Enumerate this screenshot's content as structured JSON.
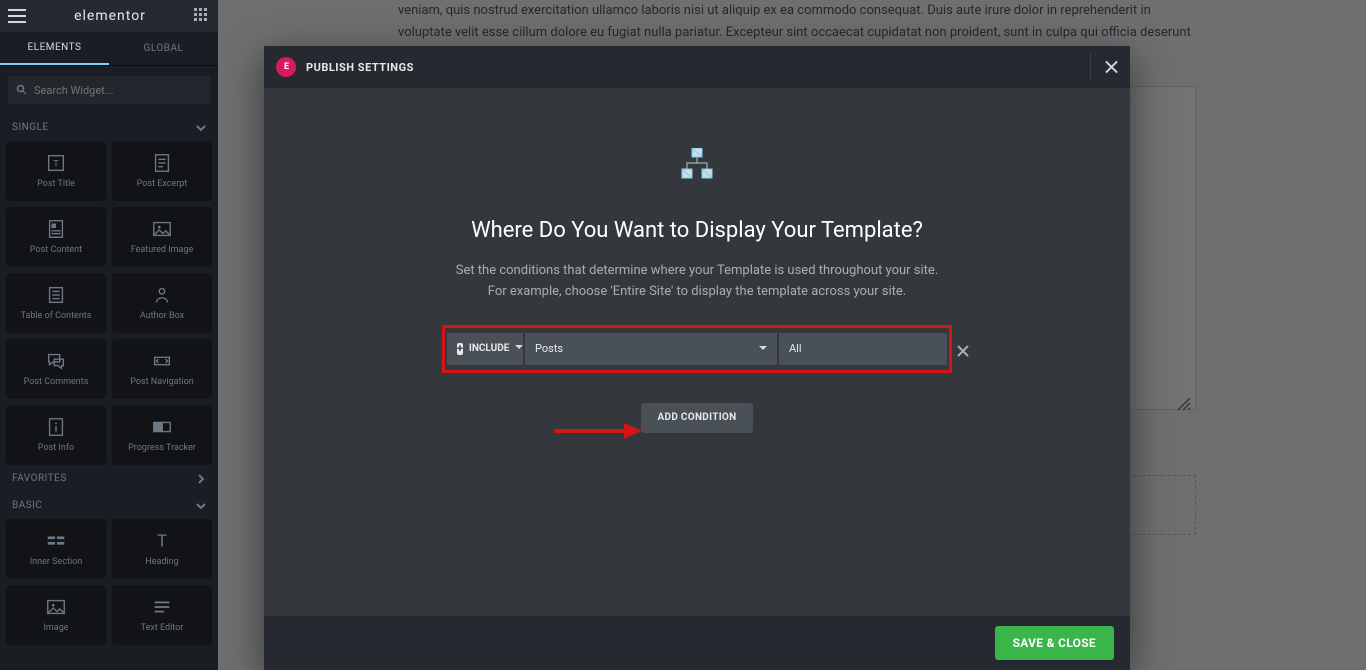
{
  "sidebar": {
    "logo": "elementor",
    "tabs": {
      "elements": "ELEMENTS",
      "global": "GLOBAL"
    },
    "search_placeholder": "Search Widget...",
    "sections": {
      "single": "SINGLE",
      "favorites": "FAVORITES",
      "basic": "BASIC"
    },
    "single_widgets": [
      "Post Title",
      "Post Excerpt",
      "Post Content",
      "Featured Image",
      "Table of Contents",
      "Author Box",
      "Post Comments",
      "Post Navigation",
      "Post Info",
      "Progress Tracker"
    ],
    "basic_widgets": [
      "Inner Section",
      "Heading",
      "Image",
      "Text Editor"
    ]
  },
  "canvas": {
    "lorem": "veniam, quis nostrud exercitation ullamco laboris nisi ut aliquip ex ea commodo consequat. Duis aute irure dolor in reprehenderit in voluptate velit esse cillum dolore eu fugiat nulla pariatur. Excepteur sint occaecat cupidatat non proident, sunt in culpa qui officia deserunt mollit anim id est laborum."
  },
  "modal": {
    "title": "PUBLISH SETTINGS",
    "heading": "Where Do You Want to Display Your Template?",
    "sub1": "Set the conditions that determine where your Template is used throughout your site.",
    "sub2": "For example, choose 'Entire Site' to display the template across your site.",
    "condition": {
      "mode": "INCLUDE",
      "type": "Posts",
      "scope": "All"
    },
    "add_button": "ADD CONDITION",
    "save_button": "SAVE & CLOSE"
  }
}
